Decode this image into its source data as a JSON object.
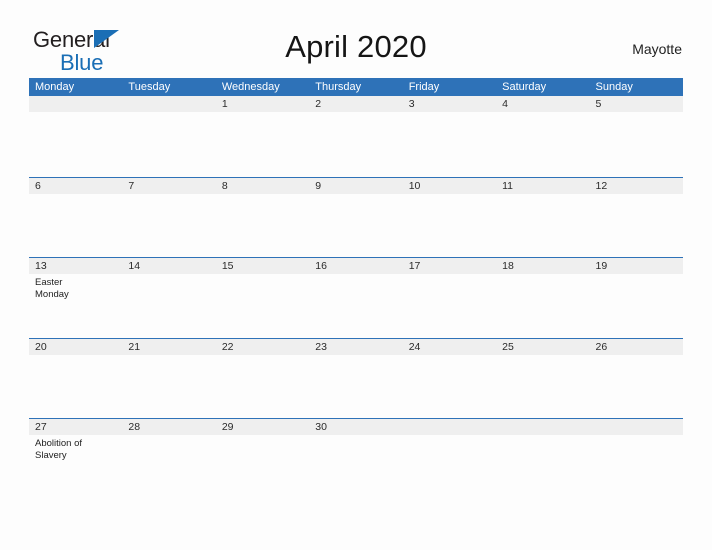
{
  "brand": {
    "line1": "General",
    "line2": "Blue",
    "accent_color": "#1a6eb5"
  },
  "header": {
    "title": "April 2020",
    "location": "Mayotte"
  },
  "theme": {
    "header_blue": "#2e72b8",
    "band_gray": "#efefef",
    "page_background": "#fdfdfd",
    "text_color": "#2a2a2a"
  },
  "calendar": {
    "month": "April",
    "year": "2020",
    "weekday_headers": [
      "Monday",
      "Tuesday",
      "Wednesday",
      "Thursday",
      "Friday",
      "Saturday",
      "Sunday"
    ],
    "weeks": [
      [
        {
          "day": "",
          "events": []
        },
        {
          "day": "",
          "events": []
        },
        {
          "day": "1",
          "events": []
        },
        {
          "day": "2",
          "events": []
        },
        {
          "day": "3",
          "events": []
        },
        {
          "day": "4",
          "events": []
        },
        {
          "day": "5",
          "events": []
        }
      ],
      [
        {
          "day": "6",
          "events": []
        },
        {
          "day": "7",
          "events": []
        },
        {
          "day": "8",
          "events": []
        },
        {
          "day": "9",
          "events": []
        },
        {
          "day": "10",
          "events": []
        },
        {
          "day": "11",
          "events": []
        },
        {
          "day": "12",
          "events": []
        }
      ],
      [
        {
          "day": "13",
          "events": [
            "Easter Monday"
          ]
        },
        {
          "day": "14",
          "events": []
        },
        {
          "day": "15",
          "events": []
        },
        {
          "day": "16",
          "events": []
        },
        {
          "day": "17",
          "events": []
        },
        {
          "day": "18",
          "events": []
        },
        {
          "day": "19",
          "events": []
        }
      ],
      [
        {
          "day": "20",
          "events": []
        },
        {
          "day": "21",
          "events": []
        },
        {
          "day": "22",
          "events": []
        },
        {
          "day": "23",
          "events": []
        },
        {
          "day": "24",
          "events": []
        },
        {
          "day": "25",
          "events": []
        },
        {
          "day": "26",
          "events": []
        }
      ],
      [
        {
          "day": "27",
          "events": [
            "Abolition of Slavery"
          ]
        },
        {
          "day": "28",
          "events": []
        },
        {
          "day": "29",
          "events": []
        },
        {
          "day": "30",
          "events": []
        },
        {
          "day": "",
          "events": []
        },
        {
          "day": "",
          "events": []
        },
        {
          "day": "",
          "events": []
        }
      ]
    ]
  }
}
